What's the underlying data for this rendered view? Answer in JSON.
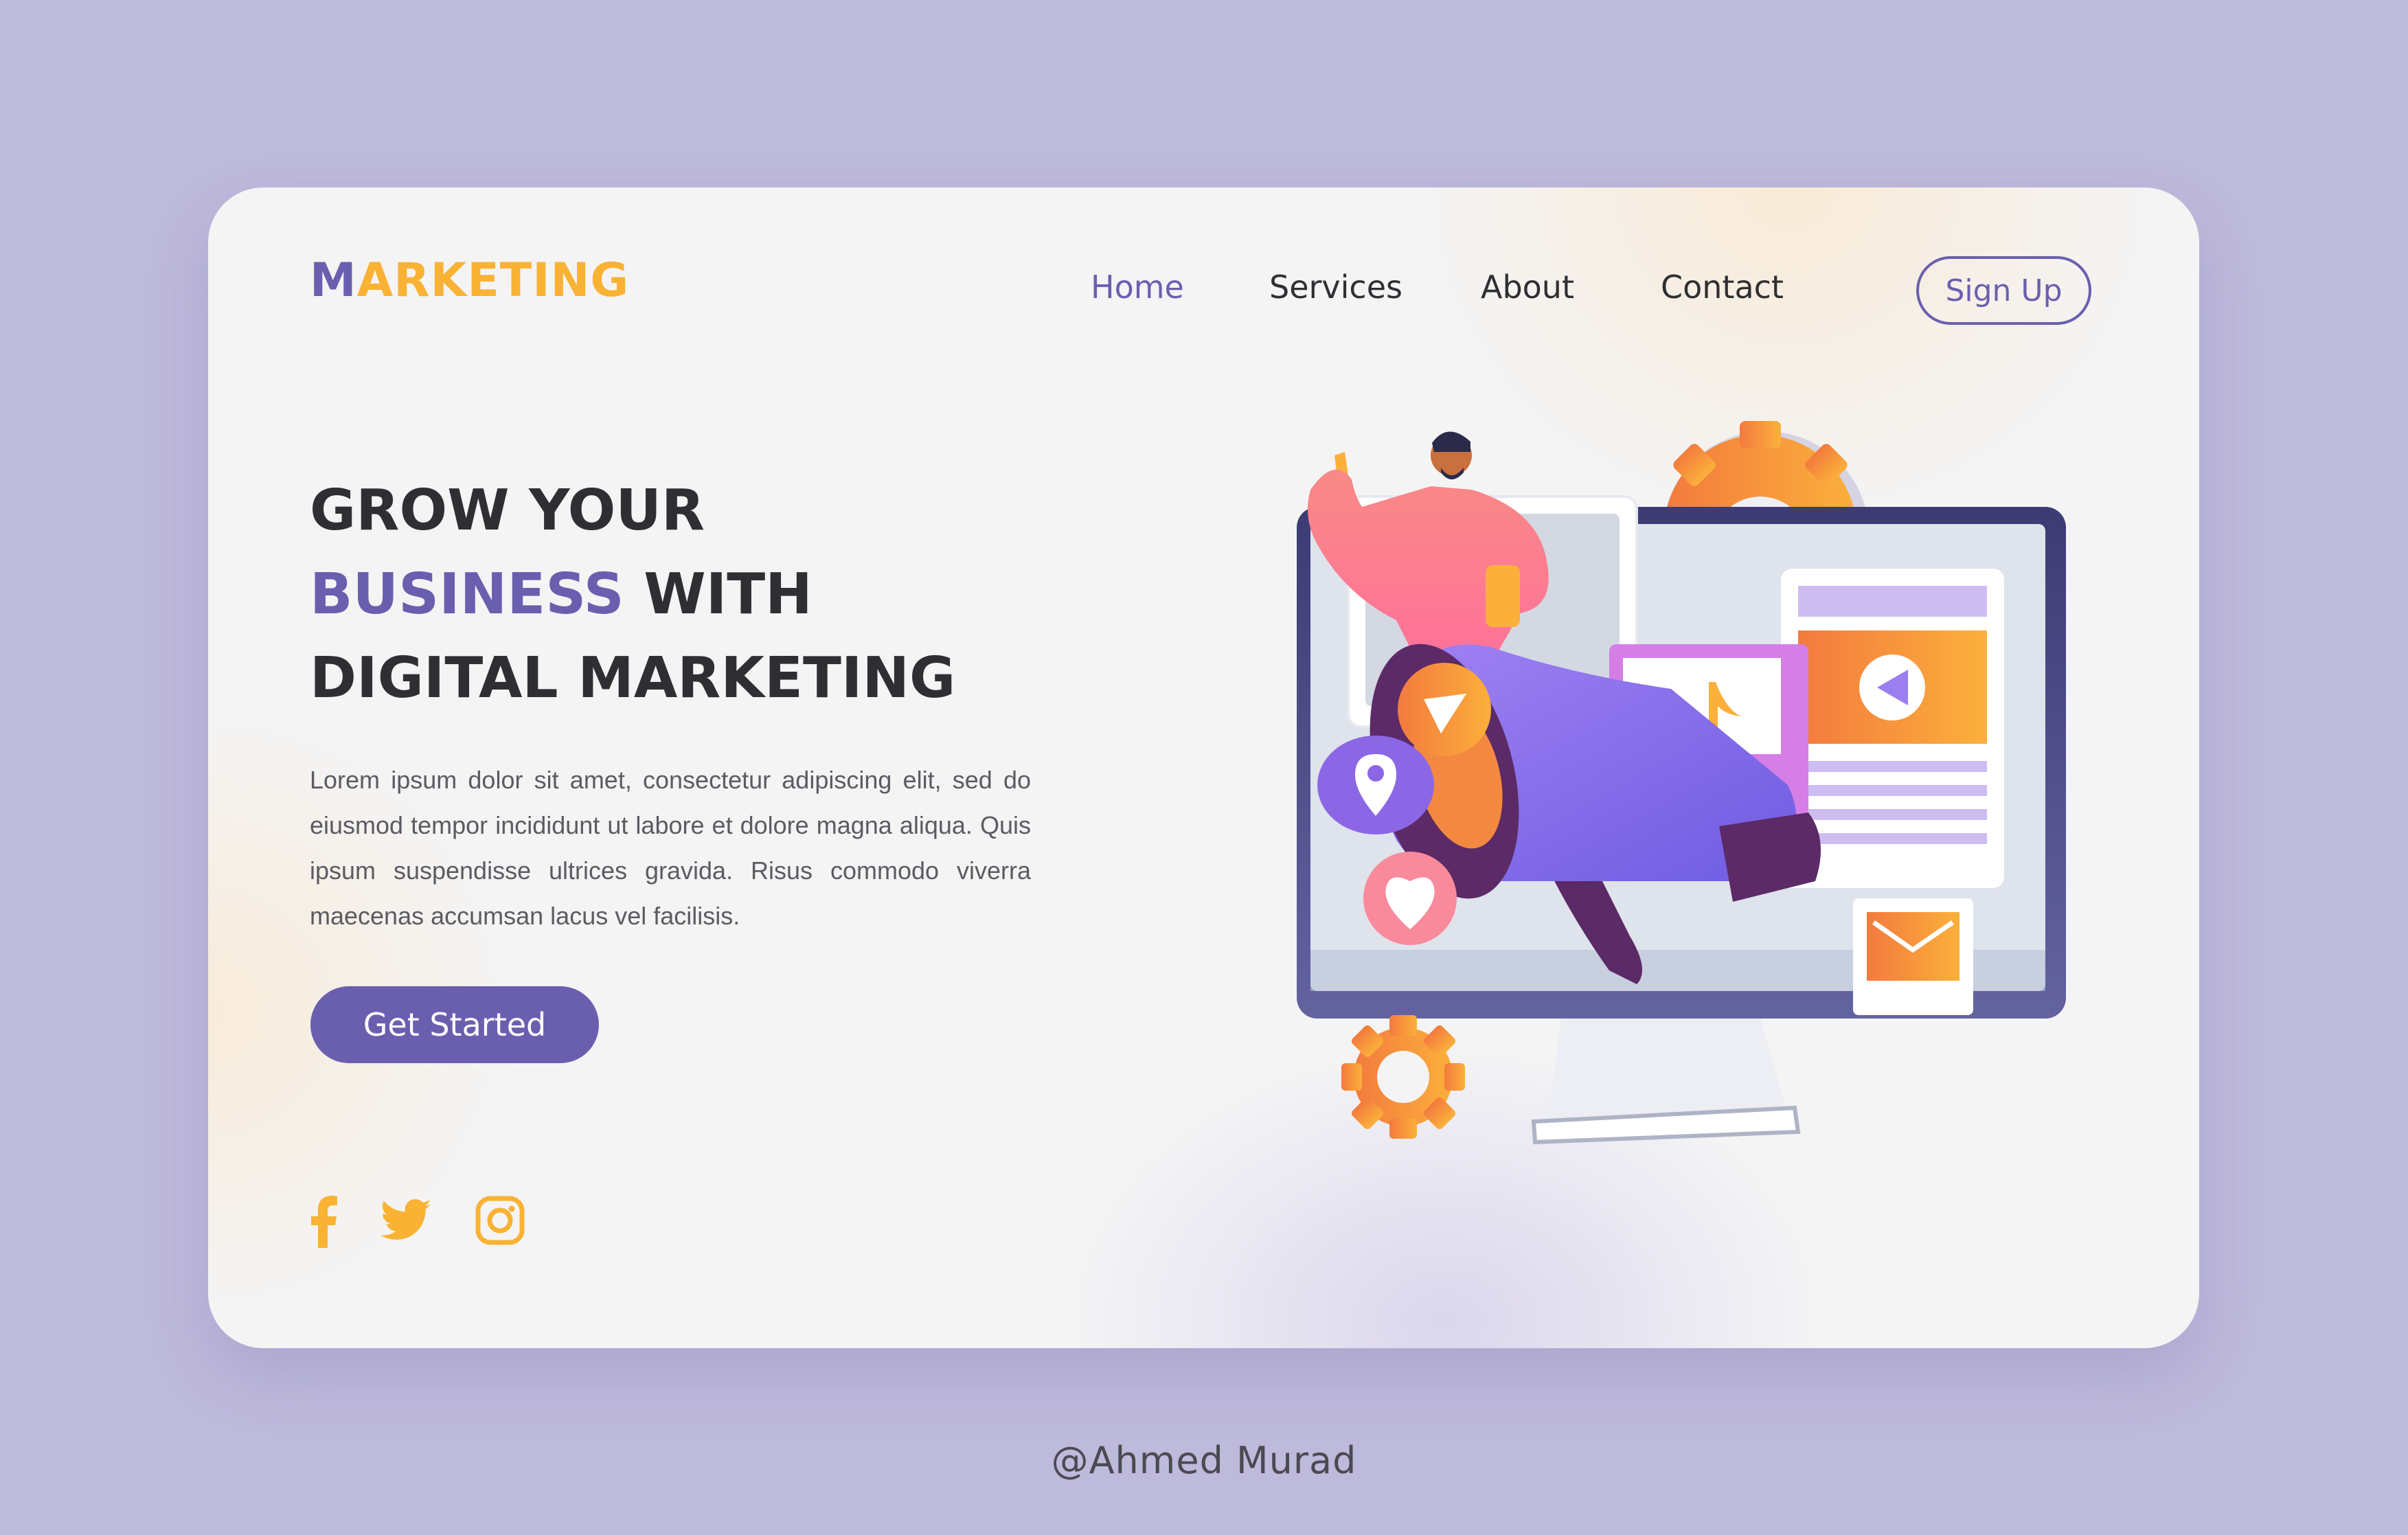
{
  "brand": {
    "logo_first": "M",
    "logo_rest": "ARKETING",
    "primary_color": "#6a5fae",
    "accent_color": "#f9b233",
    "background_color": "#bebadc"
  },
  "nav": {
    "items": [
      {
        "label": "Home",
        "active": true
      },
      {
        "label": "Services",
        "active": false
      },
      {
        "label": "About",
        "active": false
      },
      {
        "label": "Contact",
        "active": false
      }
    ],
    "signup_label": "Sign Up"
  },
  "hero": {
    "headline_line1": "GROW YOUR",
    "headline_line2_accent": "BUSINESS",
    "headline_line2_rest": " WITH",
    "headline_line3": "DIGITAL MARKETING",
    "description": "Lorem ipsum dolor sit amet, consectetur adipiscing elit, sed do eiusmod tempor incididunt ut labore et dolore magna aliqua. Quis ipsum suspendisse ultrices gravida. Risus commodo viverra maecenas accumsan lacus vel facilisis.",
    "cta_label": "Get Started"
  },
  "social": {
    "icons": [
      "facebook-icon",
      "twitter-icon",
      "instagram-icon"
    ]
  },
  "illustration": {
    "subject": "digital-marketing-megaphone-monitor",
    "icons": [
      "gear-icon",
      "megaphone-icon",
      "play-icon",
      "location-pin-icon",
      "heart-icon",
      "music-note-icon",
      "mail-icon"
    ]
  },
  "credit": "@Ahmed Murad"
}
